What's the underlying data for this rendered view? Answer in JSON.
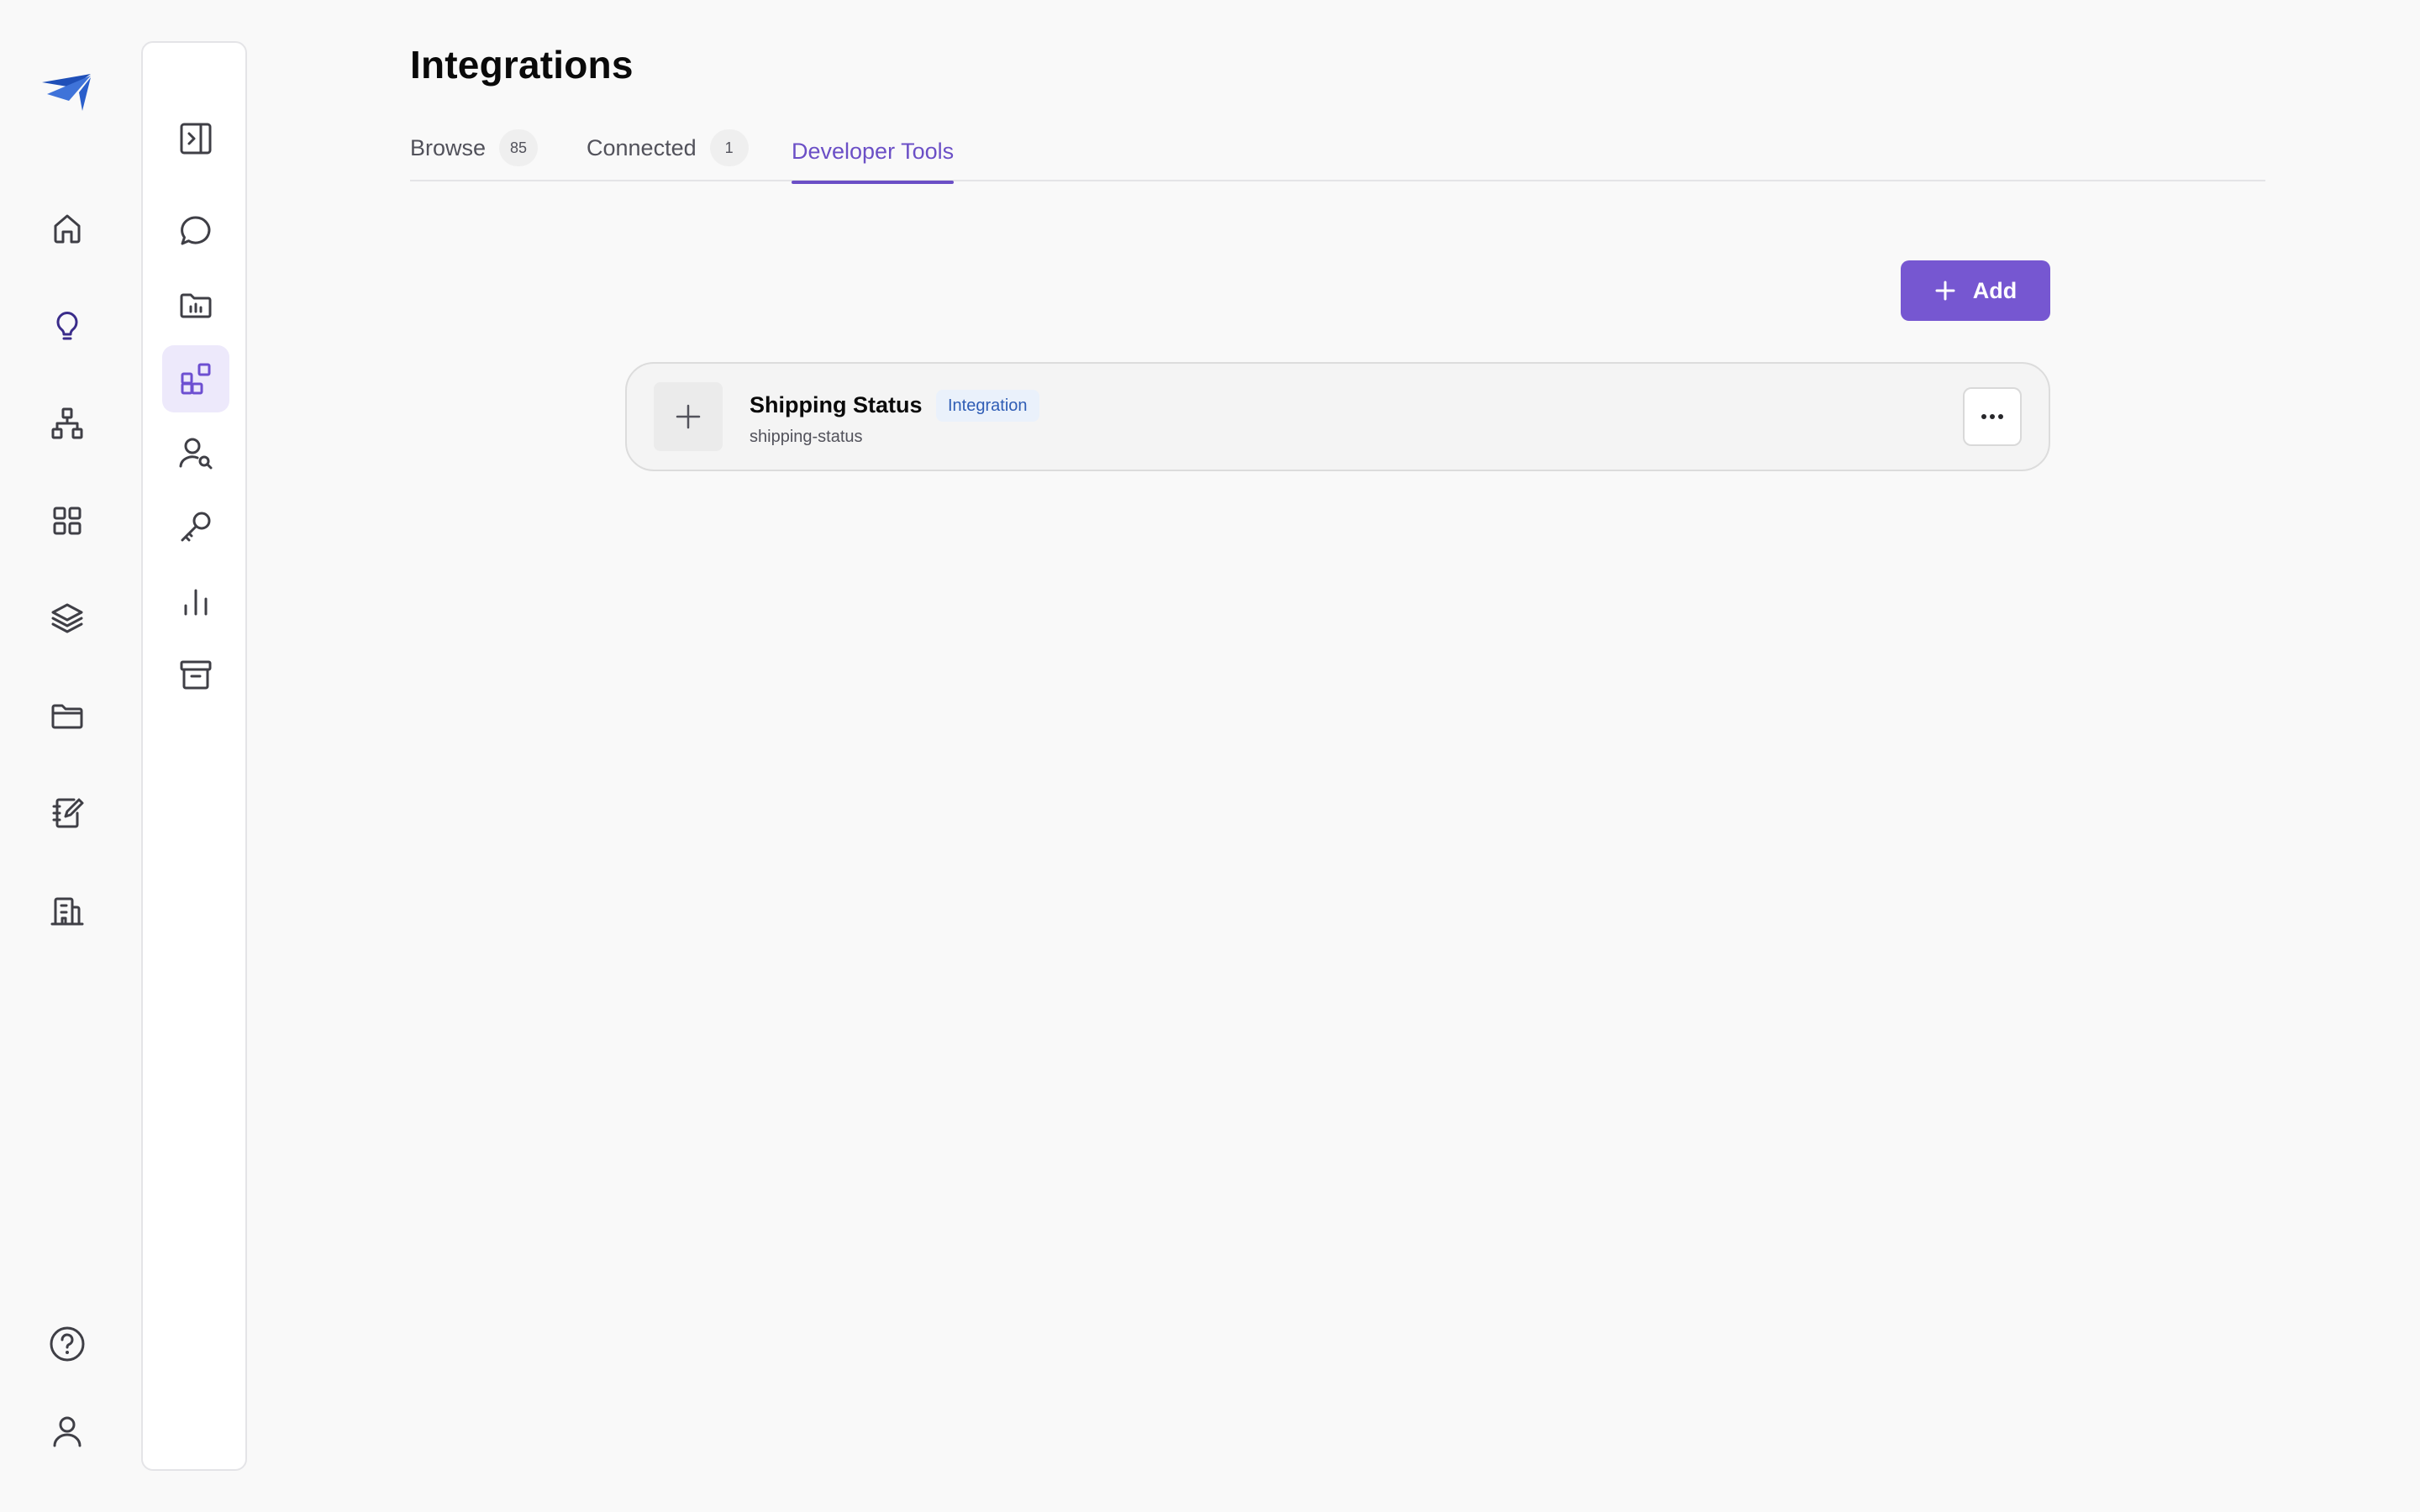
{
  "page": {
    "title": "Integrations"
  },
  "tabs": [
    {
      "label": "Browse",
      "count": "85"
    },
    {
      "label": "Connected",
      "count": "1"
    },
    {
      "label": "Developer Tools"
    }
  ],
  "toolbar": {
    "add_label": "Add"
  },
  "integrations": [
    {
      "name": "Shipping Status",
      "badge": "Integration",
      "slug": "shipping-status"
    }
  ],
  "rail": {
    "icons": [
      "home-icon",
      "lightbulb-icon",
      "org-chart-icon",
      "grid-icon",
      "layers-icon",
      "folder-icon",
      "notebook-edit-icon",
      "building-icon",
      "help-icon",
      "user-icon"
    ],
    "active": "lightbulb-icon"
  },
  "panel": {
    "icons": [
      "collapse-panel-icon",
      "chat-icon",
      "folder-chart-icon",
      "integrations-icon",
      "user-search-icon",
      "key-icon",
      "bar-chart-icon",
      "archive-icon"
    ],
    "active": "integrations-icon"
  },
  "colors": {
    "accent": "#7657d1",
    "active_tab": "#6b4fc6",
    "background": "#f9f9f9",
    "badge_bg": "#eaf1fb",
    "badge_text": "#2f5db5"
  }
}
